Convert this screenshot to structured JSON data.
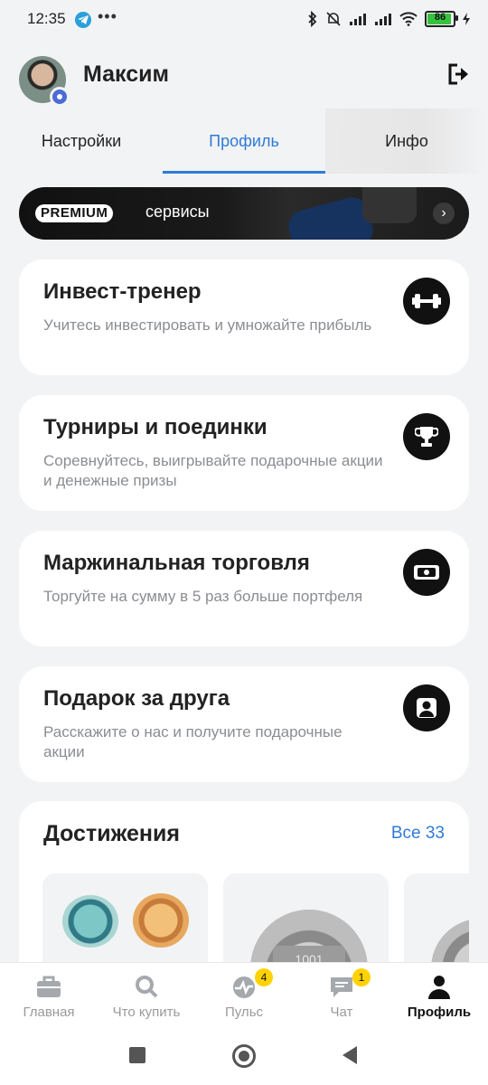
{
  "status_bar": {
    "time": "12:35",
    "more": "•••",
    "battery_level": "86"
  },
  "header": {
    "user_name": "Максим"
  },
  "tabs": [
    {
      "label": "Настройки"
    },
    {
      "label": "Профиль"
    },
    {
      "label": "Инфо"
    }
  ],
  "premium": {
    "badge": "PREMIUM",
    "label": "сервисы"
  },
  "cards": [
    {
      "title": "Инвест-тренер",
      "description": "Учитесь инвестировать и умножайте прибыль",
      "icon": "dumbbell-icon"
    },
    {
      "title": "Турниры и поединки",
      "description": "Соревнуйтесь, выигрывайте подарочные акции и денежные призы",
      "icon": "trophy-icon"
    },
    {
      "title": "Маржинальная торговля",
      "description": "Торгуйте на сумму в 5 раз больше портфеля",
      "icon": "banknote-icon"
    },
    {
      "title": "Подарок за друга",
      "description": "Расскажите о нас и получите подарочные акции",
      "icon": "person-icon"
    }
  ],
  "achievements": {
    "title": "Достижения",
    "all_link": "Все 33",
    "plaque_text": "1001"
  },
  "bottom_nav": [
    {
      "label": "Главная",
      "badge": ""
    },
    {
      "label": "Что купить",
      "badge": ""
    },
    {
      "label": "Пульс",
      "badge": "4"
    },
    {
      "label": "Чат",
      "badge": "1"
    },
    {
      "label": "Профиль",
      "badge": ""
    }
  ],
  "colors": {
    "accent": "#2f7bd6",
    "background": "#f2f3f5",
    "badge": "#ffd200"
  }
}
